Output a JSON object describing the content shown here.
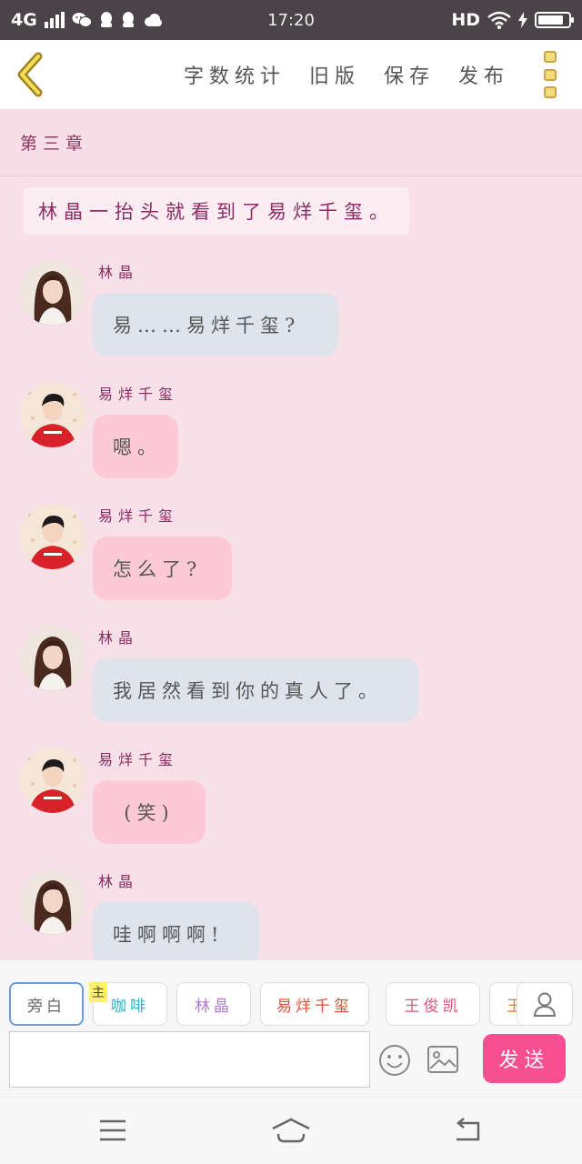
{
  "status_bar": {
    "network": "4G",
    "time": "17:20",
    "hd": "HD",
    "battery_level": 0.85
  },
  "toolbar": {
    "word_count": "字数统计",
    "old_version": "旧版",
    "save": "保存",
    "publish": "发布"
  },
  "chapter_title": "第三章",
  "narration": "林晶一抬头就看到了易烊千玺。",
  "messages": [
    {
      "sender": "林晶",
      "text": "易……易烊千玺?",
      "side": "girl",
      "bubble_color": "#dfe3ec"
    },
    {
      "sender": "易烊千玺",
      "text": "嗯。",
      "side": "boy",
      "bubble_color": "#fccad6"
    },
    {
      "sender": "易烊千玺",
      "text": "怎么了?",
      "side": "boy",
      "bubble_color": "#fccad6"
    },
    {
      "sender": "林晶",
      "text": "我居然看到你的真人了。",
      "side": "girl",
      "bubble_color": "#dfe3ec"
    },
    {
      "sender": "易烊千玺",
      "text": "(笑)",
      "side": "boy",
      "bubble_color": "#fccad6"
    },
    {
      "sender": "林晶",
      "text": "哇啊啊啊!",
      "side": "girl",
      "bubble_color": "#dfe3ec"
    }
  ],
  "roles": [
    {
      "label": "旁白",
      "color": "#666666"
    },
    {
      "label": "咖啡",
      "color": "#2fb0c0",
      "tag": "主"
    },
    {
      "label": "林晶",
      "color": "#b07ad0"
    },
    {
      "label": "易烊千玺",
      "color": "#e0503a"
    },
    {
      "label": "王俊凯",
      "color": "#e0507a"
    },
    {
      "label": "王",
      "color": "#e07a30"
    }
  ],
  "input": {
    "value": "",
    "placeholder": ""
  },
  "send_label": "发送",
  "colors": {
    "accent": "#f74f8f",
    "background": "#f8e0e8",
    "girl_bubble": "#dfe3ec",
    "boy_bubble": "#fccad6",
    "name_color": "#8a2b62"
  }
}
